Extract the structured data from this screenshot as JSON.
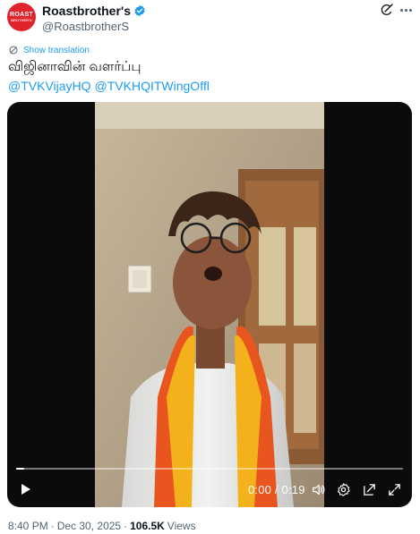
{
  "author": {
    "avatar_text_1": "ROAST",
    "avatar_text_2": "BROTHER'S",
    "display_name": "Roastbrother's",
    "handle": "@RoastbrotherS",
    "verified": true
  },
  "translation": {
    "label": "Show translation"
  },
  "tweet": {
    "text": "விஜினாவின் வளர்ப்பு",
    "mentions": [
      "@TVKVijayHQ",
      "@TVKHQITWingOffl"
    ]
  },
  "video": {
    "current_time": "0:00",
    "duration": "0:19",
    "time_display": "0:00 / 0:19",
    "progress_fraction": 0.02,
    "controls": [
      "play-icon",
      "volume-icon",
      "settings-icon",
      "popout-icon",
      "fullscreen-icon"
    ]
  },
  "meta": {
    "time": "8:40 PM",
    "separator": "·",
    "date": "Dec 30, 2025",
    "views_count": "106.5K",
    "views_label": "Views"
  },
  "colors": {
    "link": "#1d9bf0",
    "text": "#0f1419",
    "secondary": "#536471",
    "avatar_red": "#e0242c"
  }
}
